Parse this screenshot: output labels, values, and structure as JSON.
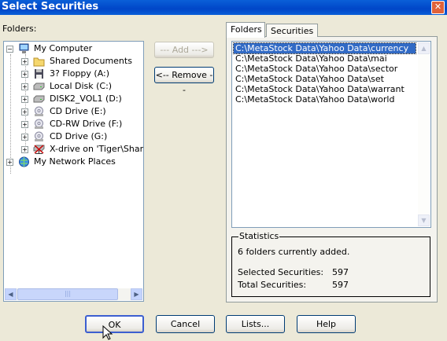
{
  "window": {
    "title": "Select Securities",
    "close_icon": "close-icon"
  },
  "folders_label": "Folders:",
  "tree": [
    {
      "label": "My Computer",
      "icon": "computer-icon",
      "expander": "−"
    },
    {
      "label": "Shared Documents",
      "icon": "folder-icon",
      "expander": "+"
    },
    {
      "label": "3? Floppy (A:)",
      "icon": "floppy-icon",
      "expander": "+"
    },
    {
      "label": "Local Disk (C:)",
      "icon": "disk-icon",
      "expander": "+"
    },
    {
      "label": "DISK2_VOL1 (D:)",
      "icon": "disk-icon",
      "expander": "+"
    },
    {
      "label": "CD Drive (E:)",
      "icon": "cd-icon",
      "expander": "+"
    },
    {
      "label": "CD-RW Drive (F:)",
      "icon": "cd-icon",
      "expander": "+"
    },
    {
      "label": "CD Drive (G:)",
      "icon": "cd-icon",
      "expander": "+"
    },
    {
      "label": "X-drive on 'Tiger\\Shared",
      "icon": "network-drive-icon",
      "expander": "+"
    },
    {
      "label": "My Network Places",
      "icon": "network-places-icon",
      "expander": "+"
    }
  ],
  "buttons": {
    "add": "--- Add --->",
    "remove": "<-- Remove --",
    "ok": "OK",
    "cancel": "Cancel",
    "lists": "Lists...",
    "help": "Help"
  },
  "tabs": [
    {
      "label": "Folders",
      "active": true
    },
    {
      "label": "Securities",
      "active": false
    }
  ],
  "added_folders": [
    "C:\\MetaStock Data\\Yahoo Data\\currency",
    "C:\\MetaStock Data\\Yahoo Data\\mai",
    "C:\\MetaStock Data\\Yahoo Data\\sector",
    "C:\\MetaStock Data\\Yahoo Data\\set",
    "C:\\MetaStock Data\\Yahoo Data\\warrant",
    "C:\\MetaStock Data\\Yahoo Data\\world"
  ],
  "statistics": {
    "title": "Statistics",
    "summary": "6 folders currently added.",
    "selected_label": "Selected Securities:",
    "selected_value": "597",
    "total_label": "Total Securities:",
    "total_value": "597"
  },
  "colors": {
    "title_bar": "#0a5fd8",
    "selection": "#316ac5",
    "dialog_bg": "#ece9d8"
  }
}
